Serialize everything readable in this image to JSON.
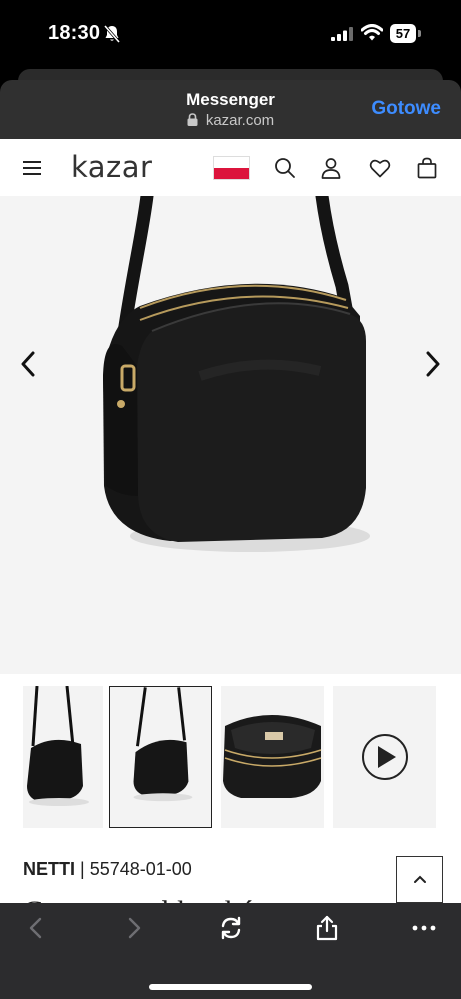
{
  "status_bar": {
    "time": "18:30",
    "battery": "57",
    "icons": [
      "bell-slash-icon",
      "signal-icon",
      "wifi-icon",
      "battery-icon"
    ]
  },
  "sheet": {
    "title": "Messenger",
    "url": "kazar.com",
    "done_label": "Gotowe"
  },
  "site": {
    "logo": "kazar",
    "flag": "Poland"
  },
  "product": {
    "name": "NETTI",
    "separator": "|",
    "code": "55748-01-00",
    "title_partial": "Czarna torebka skórzana",
    "thumbnails": [
      "thumbnail-front",
      "thumbnail-side",
      "thumbnail-interior",
      "thumbnail-video"
    ],
    "selected_thumbnail": 1
  },
  "colors": {
    "accent": "#3d8cff",
    "flag_red": "#dc143c",
    "toolbar": "#2c2c2e"
  }
}
